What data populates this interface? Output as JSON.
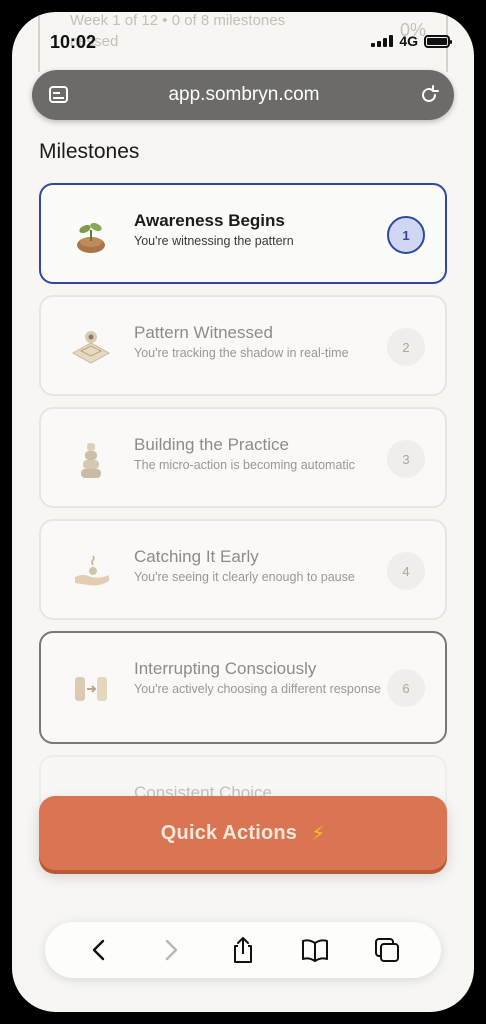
{
  "status_bar": {
    "time": "10:02",
    "network": "4G"
  },
  "ghost_header": {
    "line1": "Week 1 of 12 • 0 of 8 milestones",
    "line2": "nessed",
    "percent": "0%"
  },
  "browser": {
    "url": "app.sombryn.com"
  },
  "section": {
    "title": "Milestones"
  },
  "milestones": [
    {
      "title": "Awareness Begins",
      "subtitle": "You're witnessing the pattern",
      "number": "1",
      "icon": "sprout-icon"
    },
    {
      "title": "Pattern Witnessed",
      "subtitle": "You're tracking the shadow in real-time",
      "number": "2",
      "icon": "eye-tile-icon"
    },
    {
      "title": "Building the Practice",
      "subtitle": "The micro-action is becoming automatic",
      "number": "3",
      "icon": "stacked-stones-icon"
    },
    {
      "title": "Catching It Early",
      "subtitle": "You're seeing it clearly enough to pause",
      "number": "4",
      "icon": "hand-catch-icon"
    },
    {
      "title": "Interrupting Consciously",
      "subtitle": "You're actively choosing a different response",
      "number": "6",
      "icon": "pause-blocks-icon"
    },
    {
      "title": "Consistent Choice",
      "subtitle": "",
      "number": "",
      "icon": "dots-icon"
    }
  ],
  "quick_actions": {
    "label": "Quick Actions",
    "icon": "lightning-icon",
    "accent": "#d97552"
  },
  "toolbar": {
    "icons": [
      "back-icon",
      "forward-icon",
      "share-icon",
      "bookmarks-icon",
      "tabs-icon"
    ]
  },
  "colors": {
    "active_border": "#2f48a8",
    "background": "#f7f6f3"
  }
}
